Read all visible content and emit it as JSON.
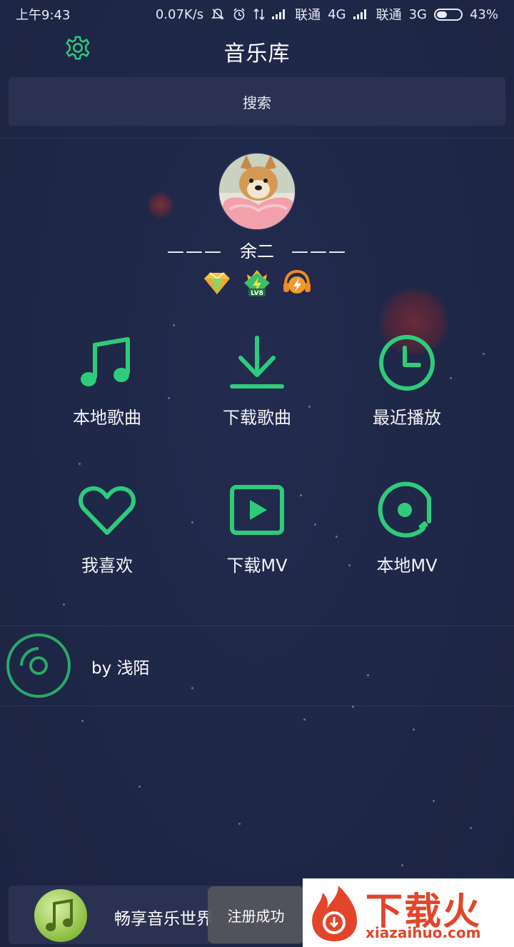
{
  "status_bar": {
    "time": "上午9:43",
    "speed": "0.07K/s",
    "carrier1": "联通",
    "net1": "4G",
    "carrier2": "联通",
    "net2": "3G",
    "battery": "43%",
    "battery_level": 0.43
  },
  "header": {
    "title": "音乐库",
    "settings_icon": "gear-icon"
  },
  "search": {
    "label": "搜索"
  },
  "profile": {
    "dash_left": "———",
    "name": "余二",
    "dash_right": "———",
    "level_badge": "LV8",
    "badges": [
      "diamond-icon",
      "level-crown-icon",
      "lightning-headphone-icon"
    ]
  },
  "grid": {
    "items": [
      {
        "label": "本地歌曲",
        "icon": "music-note-icon"
      },
      {
        "label": "下载歌曲",
        "icon": "download-icon"
      },
      {
        "label": "最近播放",
        "icon": "clock-icon"
      },
      {
        "label": "我喜欢",
        "icon": "heart-icon"
      },
      {
        "label": "下载MV",
        "icon": "play-video-icon"
      },
      {
        "label": "本地MV",
        "icon": "disc-play-icon"
      }
    ]
  },
  "playlist": {
    "text": "by 浅陌",
    "icon": "vinyl-disc-icon"
  },
  "player": {
    "text": "畅享音乐世界",
    "icon": "music-note-cover-icon"
  },
  "toast": {
    "text": "注册成功"
  },
  "watermark": {
    "cn": "下载火",
    "en": "xiazaihuo.com"
  },
  "colors": {
    "accent": "#2ecc7a",
    "background": "#1f2748",
    "panel": "#2b3251",
    "watermark": "#e2452a"
  }
}
